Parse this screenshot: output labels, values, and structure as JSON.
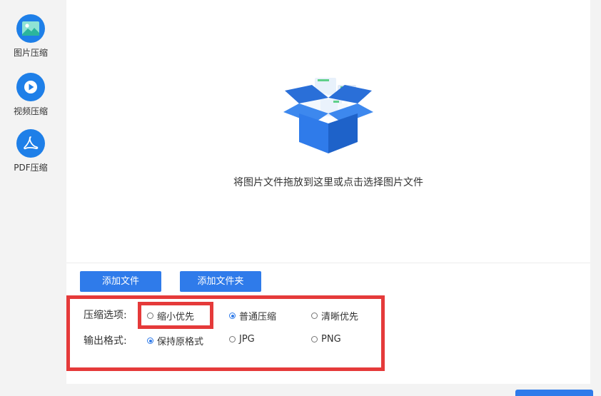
{
  "sidebar": {
    "items": [
      {
        "label": "图片压缩",
        "icon": "image-icon"
      },
      {
        "label": "视频压缩",
        "icon": "play-icon"
      },
      {
        "label": "PDF压缩",
        "icon": "pdf-icon"
      }
    ]
  },
  "dropzone": {
    "text": "将图片文件拖放到这里或点击选择图片文件"
  },
  "buttons": {
    "add_file": "添加文件",
    "add_folder": "添加文件夹"
  },
  "compression": {
    "label": "压缩选项:",
    "options": [
      "缩小优先",
      "普通压缩",
      "清晰优先"
    ],
    "selected": "普通压缩"
  },
  "output": {
    "label": "输出格式:",
    "options": [
      "保持原格式",
      "JPG",
      "PNG"
    ],
    "selected": "保持原格式"
  },
  "colors": {
    "accent": "#2f7bea",
    "annotation": "#e53a3a"
  }
}
